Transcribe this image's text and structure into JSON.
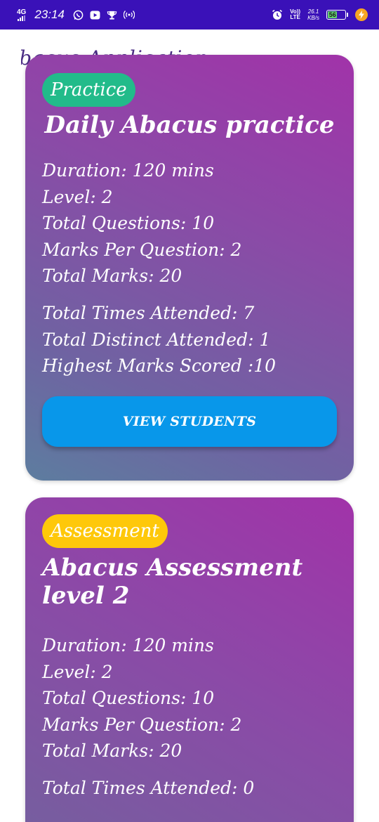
{
  "status_bar": {
    "network": "4G",
    "time": "23:14",
    "volte_top": "Vo))",
    "volte_bottom": "LTE",
    "speed_value": "26.1",
    "speed_unit": "KB/s",
    "battery_level": "56",
    "battery_fraction": 0.56
  },
  "app": {
    "title": "Abacus Application"
  },
  "cards": [
    {
      "badge": "Practice",
      "title": "Daily Abacus practice",
      "duration": "Duration: 120 mins",
      "level": "Level: 2",
      "total_questions": "Total Questions: 10",
      "marks_per_question": "Marks Per Question: 2",
      "total_marks": "Total Marks: 20",
      "times_attended": "Total Times Attended: 7",
      "distinct_attended": "Total Distinct Attended: 1",
      "highest_marks": "Highest Marks Scored :10",
      "button_label": "VIEW STUDENTS"
    },
    {
      "badge": "Assessment",
      "title": "Abacus Assessment level 2",
      "duration": "Duration: 120 mins",
      "level": "Level: 2",
      "total_questions": "Total Questions: 10",
      "marks_per_question": "Marks Per Question: 2",
      "total_marks": "Total Marks: 20",
      "times_attended": "Total Times Attended: 0"
    }
  ],
  "colors": {
    "status_bar": "#3a11b8",
    "practice_badge": "#22bb8a",
    "assessment_badge": "#fec80a",
    "button": "#0897ea",
    "card_top": "#a133a9",
    "card_bottom": "#5d7d9f"
  }
}
